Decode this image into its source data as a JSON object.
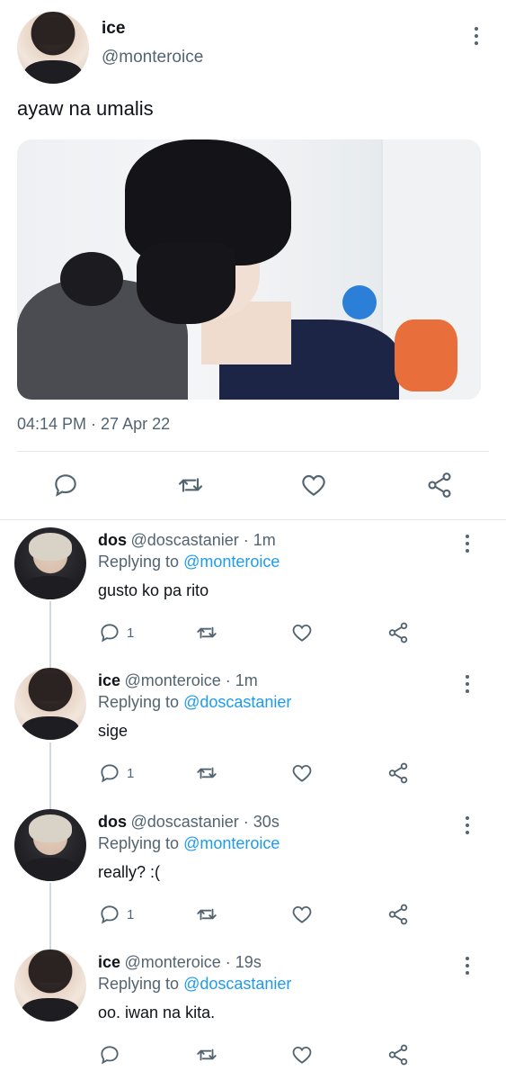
{
  "main_tweet": {
    "author_name": "ice",
    "author_handle": "@monteroice",
    "text": "ayaw na umalis",
    "timestamp": "04:14 PM · 27 Apr 22",
    "more_icon": "more-vertical-icon"
  },
  "replies": [
    {
      "name": "dos",
      "handle_time": "@doscastanier · 1m",
      "replying_prefix": "Replying to",
      "replying_to": "@monteroice",
      "text": "gusto ko pa rito",
      "reply_count": "1"
    },
    {
      "name": "ice",
      "handle_time": "@monteroice · 1m",
      "replying_prefix": "Replying to",
      "replying_to": "@doscastanier",
      "text": "sige",
      "reply_count": "1"
    },
    {
      "name": "dos",
      "handle_time": "@doscastanier · 30s",
      "replying_prefix": "Replying to",
      "replying_to": "@monteroice",
      "text": "really? :(",
      "reply_count": "1"
    },
    {
      "name": "ice",
      "handle_time": "@monteroice · 19s",
      "replying_prefix": "Replying to",
      "replying_to": "@doscastanier",
      "text": "oo. iwan na kita.",
      "reply_count": ""
    }
  ],
  "icons": {
    "reply": "reply-icon",
    "retweet": "retweet-icon",
    "like": "like-icon",
    "share": "share-icon"
  },
  "colors": {
    "accent": "#1d9bf0",
    "secondary_text": "#536471",
    "icon": "#536471"
  }
}
